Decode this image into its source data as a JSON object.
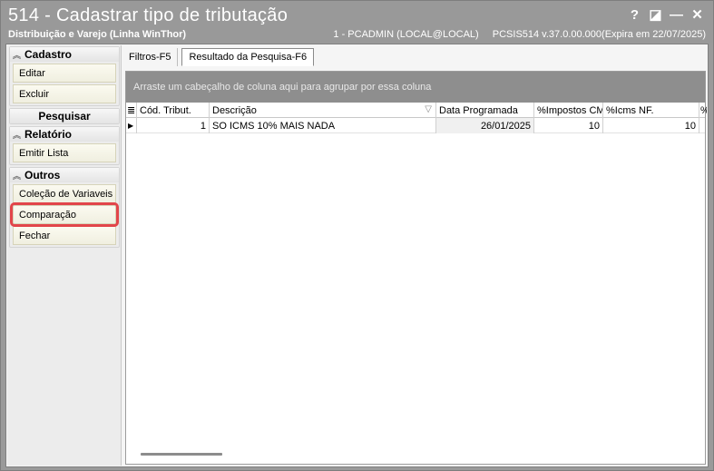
{
  "window": {
    "title": "514 - Cadastrar tipo de tributação",
    "subtitle": "Distribuição e Varejo (Linha WinThor)",
    "user_info": "1 - PCADMIN (LOCAL@LOCAL)",
    "version_info": "PCSIS514  v.37.0.00.000(Expira em 22/07/2025)",
    "controls": {
      "help": "?",
      "restore": "◪",
      "minimize": "—",
      "close": "✕"
    }
  },
  "sidebar": {
    "groups": [
      {
        "label": "Cadastro",
        "items": [
          "Editar",
          "Excluir"
        ]
      },
      {
        "label": "Pesquisar",
        "items": []
      },
      {
        "label": "Relatório",
        "items": [
          "Emitir Lista"
        ]
      },
      {
        "label": "Outros",
        "items": [
          "Coleção de Variaveis",
          "Comparação",
          "Fechar"
        ]
      }
    ]
  },
  "tabs": [
    {
      "label": "Filtros-F5",
      "active": false
    },
    {
      "label": "Resultado da Pesquisa-F6",
      "active": true
    }
  ],
  "grid": {
    "group_hint": "Arraste um cabeçalho de coluna aqui para agrupar por essa coluna",
    "columns": [
      "Cód. Tribut.",
      "Descrição",
      "Data Programada",
      "%Impostos CM",
      "%Icms NF.",
      "%"
    ],
    "rows": [
      {
        "cod": "1",
        "descricao": "SO ICMS 10% MAIS NADA",
        "data": "26/01/2025",
        "impostos": "10",
        "icms": "10"
      }
    ]
  },
  "colors": {
    "titlebar": "#999999",
    "highlight": "#e2454a",
    "group_panel": "#8e8e8e"
  }
}
